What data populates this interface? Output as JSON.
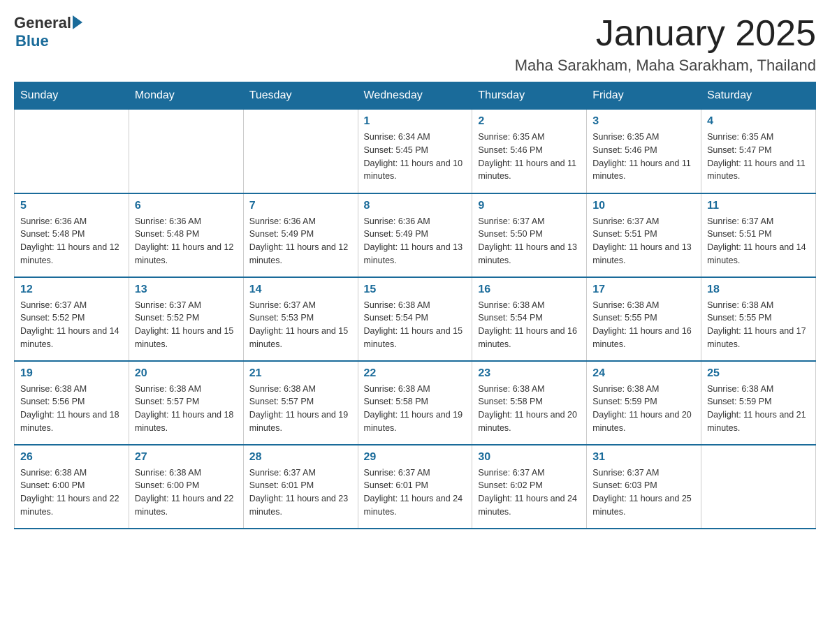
{
  "logo": {
    "general": "General",
    "blue": "Blue"
  },
  "title": "January 2025",
  "location": "Maha Sarakham, Maha Sarakham, Thailand",
  "days_of_week": [
    "Sunday",
    "Monday",
    "Tuesday",
    "Wednesday",
    "Thursday",
    "Friday",
    "Saturday"
  ],
  "weeks": [
    [
      {
        "day": "",
        "info": ""
      },
      {
        "day": "",
        "info": ""
      },
      {
        "day": "",
        "info": ""
      },
      {
        "day": "1",
        "info": "Sunrise: 6:34 AM\nSunset: 5:45 PM\nDaylight: 11 hours and 10 minutes."
      },
      {
        "day": "2",
        "info": "Sunrise: 6:35 AM\nSunset: 5:46 PM\nDaylight: 11 hours and 11 minutes."
      },
      {
        "day": "3",
        "info": "Sunrise: 6:35 AM\nSunset: 5:46 PM\nDaylight: 11 hours and 11 minutes."
      },
      {
        "day": "4",
        "info": "Sunrise: 6:35 AM\nSunset: 5:47 PM\nDaylight: 11 hours and 11 minutes."
      }
    ],
    [
      {
        "day": "5",
        "info": "Sunrise: 6:36 AM\nSunset: 5:48 PM\nDaylight: 11 hours and 12 minutes."
      },
      {
        "day": "6",
        "info": "Sunrise: 6:36 AM\nSunset: 5:48 PM\nDaylight: 11 hours and 12 minutes."
      },
      {
        "day": "7",
        "info": "Sunrise: 6:36 AM\nSunset: 5:49 PM\nDaylight: 11 hours and 12 minutes."
      },
      {
        "day": "8",
        "info": "Sunrise: 6:36 AM\nSunset: 5:49 PM\nDaylight: 11 hours and 13 minutes."
      },
      {
        "day": "9",
        "info": "Sunrise: 6:37 AM\nSunset: 5:50 PM\nDaylight: 11 hours and 13 minutes."
      },
      {
        "day": "10",
        "info": "Sunrise: 6:37 AM\nSunset: 5:51 PM\nDaylight: 11 hours and 13 minutes."
      },
      {
        "day": "11",
        "info": "Sunrise: 6:37 AM\nSunset: 5:51 PM\nDaylight: 11 hours and 14 minutes."
      }
    ],
    [
      {
        "day": "12",
        "info": "Sunrise: 6:37 AM\nSunset: 5:52 PM\nDaylight: 11 hours and 14 minutes."
      },
      {
        "day": "13",
        "info": "Sunrise: 6:37 AM\nSunset: 5:52 PM\nDaylight: 11 hours and 15 minutes."
      },
      {
        "day": "14",
        "info": "Sunrise: 6:37 AM\nSunset: 5:53 PM\nDaylight: 11 hours and 15 minutes."
      },
      {
        "day": "15",
        "info": "Sunrise: 6:38 AM\nSunset: 5:54 PM\nDaylight: 11 hours and 15 minutes."
      },
      {
        "day": "16",
        "info": "Sunrise: 6:38 AM\nSunset: 5:54 PM\nDaylight: 11 hours and 16 minutes."
      },
      {
        "day": "17",
        "info": "Sunrise: 6:38 AM\nSunset: 5:55 PM\nDaylight: 11 hours and 16 minutes."
      },
      {
        "day": "18",
        "info": "Sunrise: 6:38 AM\nSunset: 5:55 PM\nDaylight: 11 hours and 17 minutes."
      }
    ],
    [
      {
        "day": "19",
        "info": "Sunrise: 6:38 AM\nSunset: 5:56 PM\nDaylight: 11 hours and 18 minutes."
      },
      {
        "day": "20",
        "info": "Sunrise: 6:38 AM\nSunset: 5:57 PM\nDaylight: 11 hours and 18 minutes."
      },
      {
        "day": "21",
        "info": "Sunrise: 6:38 AM\nSunset: 5:57 PM\nDaylight: 11 hours and 19 minutes."
      },
      {
        "day": "22",
        "info": "Sunrise: 6:38 AM\nSunset: 5:58 PM\nDaylight: 11 hours and 19 minutes."
      },
      {
        "day": "23",
        "info": "Sunrise: 6:38 AM\nSunset: 5:58 PM\nDaylight: 11 hours and 20 minutes."
      },
      {
        "day": "24",
        "info": "Sunrise: 6:38 AM\nSunset: 5:59 PM\nDaylight: 11 hours and 20 minutes."
      },
      {
        "day": "25",
        "info": "Sunrise: 6:38 AM\nSunset: 5:59 PM\nDaylight: 11 hours and 21 minutes."
      }
    ],
    [
      {
        "day": "26",
        "info": "Sunrise: 6:38 AM\nSunset: 6:00 PM\nDaylight: 11 hours and 22 minutes."
      },
      {
        "day": "27",
        "info": "Sunrise: 6:38 AM\nSunset: 6:00 PM\nDaylight: 11 hours and 22 minutes."
      },
      {
        "day": "28",
        "info": "Sunrise: 6:37 AM\nSunset: 6:01 PM\nDaylight: 11 hours and 23 minutes."
      },
      {
        "day": "29",
        "info": "Sunrise: 6:37 AM\nSunset: 6:01 PM\nDaylight: 11 hours and 24 minutes."
      },
      {
        "day": "30",
        "info": "Sunrise: 6:37 AM\nSunset: 6:02 PM\nDaylight: 11 hours and 24 minutes."
      },
      {
        "day": "31",
        "info": "Sunrise: 6:37 AM\nSunset: 6:03 PM\nDaylight: 11 hours and 25 minutes."
      },
      {
        "day": "",
        "info": ""
      }
    ]
  ]
}
